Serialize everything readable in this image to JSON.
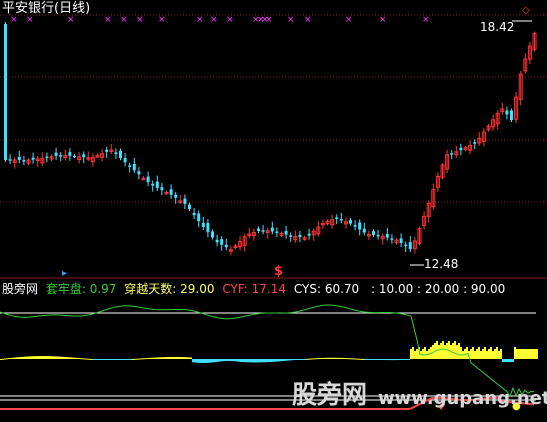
{
  "window": {
    "title": "平安银行(日线)",
    "title_color": "#ffffff"
  },
  "price_panel": {
    "high_label": "18.42",
    "low_label": "12.48",
    "signal_marker": "$",
    "marker_colors": {
      "x_marks": "#ff33ff",
      "diamond": "#ff3333",
      "s_marker": "#ff3333"
    },
    "up_color": "#ff3333",
    "down_color": "#40e0ff"
  },
  "indicator_panel": {
    "name": "股旁网",
    "items": [
      {
        "label": "套牢盘",
        "value": ": 0.97",
        "color": "#33cc33"
      },
      {
        "label": "穿越天数",
        "value": ": 29.00",
        "color": "#ffff66"
      },
      {
        "label": "CYF",
        "value": ": 17.14",
        "color": "#ff4444"
      },
      {
        "label": "CYS",
        "value": ": 60.70",
        "color": "#ffffff"
      }
    ],
    "levels_text": ": 10.00 : 20.00 : 90.00",
    "levels_color": "#ffffff",
    "colors": {
      "green_line": "#33cc33",
      "cyan_bar": "#40e0ff",
      "yellow_bar": "#ffff33",
      "red_line": "#ff4444",
      "white_line": "#ffffff"
    }
  },
  "watermark": {
    "text_cn": "股旁网",
    "text_url": "www.gupang.net"
  },
  "chart_data": [
    {
      "type": "candlestick",
      "title": "平安银行(日线)",
      "annotations": [
        "18.42",
        "12.48"
      ],
      "y_high": 18.42,
      "y_low": 12.48
    },
    {
      "type": "line",
      "series": [
        {
          "name": "套牢盘",
          "last": 0.97
        },
        {
          "name": "穿越天数",
          "last": 29.0
        },
        {
          "name": "CYF",
          "last": 17.14
        },
        {
          "name": "CYS",
          "last": 60.7
        }
      ],
      "reference_levels": [
        10.0,
        20.0,
        90.0
      ]
    }
  ]
}
